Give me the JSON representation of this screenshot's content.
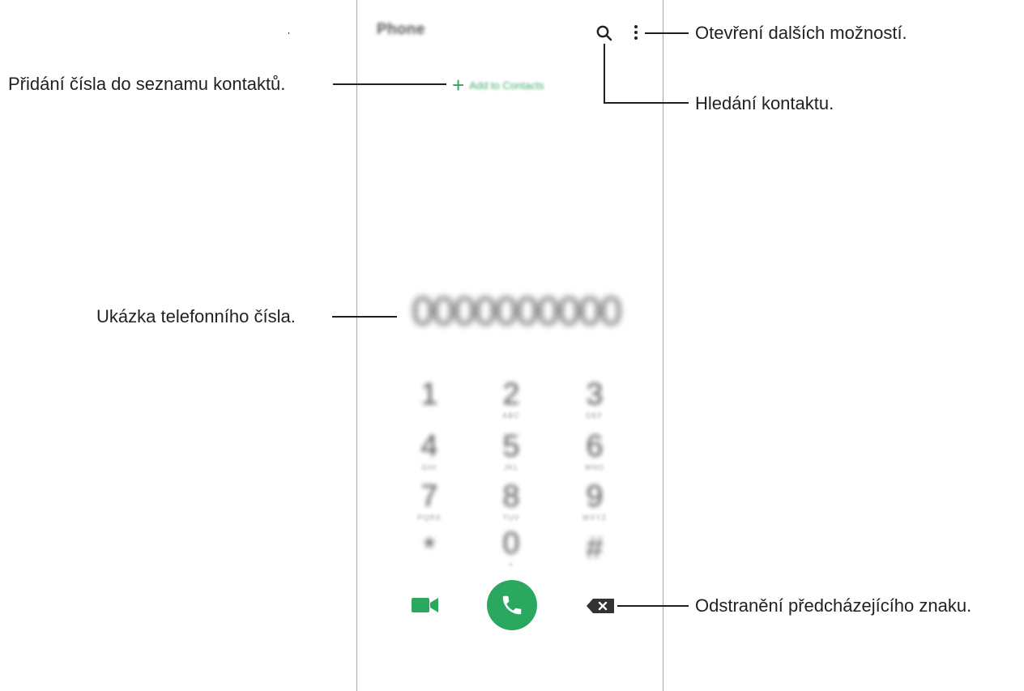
{
  "app": {
    "title": "Phone",
    "add_to_contacts": "Add to Contacts"
  },
  "dialer": {
    "number": "0000000000",
    "keys": [
      {
        "digit": "1",
        "letters": ""
      },
      {
        "digit": "2",
        "letters": "ABC"
      },
      {
        "digit": "3",
        "letters": "DEF"
      },
      {
        "digit": "4",
        "letters": "GHI"
      },
      {
        "digit": "5",
        "letters": "JKL"
      },
      {
        "digit": "6",
        "letters": "MNO"
      },
      {
        "digit": "7",
        "letters": "PQRS"
      },
      {
        "digit": "8",
        "letters": "TUV"
      },
      {
        "digit": "9",
        "letters": "WXYZ"
      },
      {
        "digit": "*",
        "letters": ""
      },
      {
        "digit": "0",
        "letters": "+"
      },
      {
        "digit": "#",
        "letters": ""
      }
    ]
  },
  "icons": {
    "search": "search-icon",
    "more": "more-options-icon",
    "add": "plus-icon",
    "video_call": "video-call-icon",
    "call": "phone-call-icon",
    "delete": "backspace-icon"
  },
  "colors": {
    "accent_green": "#2aa85f",
    "frame": "#a8a8a8"
  },
  "callouts": {
    "more_options": "Otevření dalších možností.",
    "add_to_contacts": "Přidání čísla do seznamu kontaktů.",
    "search_contact": "Hledání kontaktu.",
    "number_preview": "Ukázka telefonního čísla.",
    "delete_char": "Odstranění předcházejícího znaku."
  }
}
